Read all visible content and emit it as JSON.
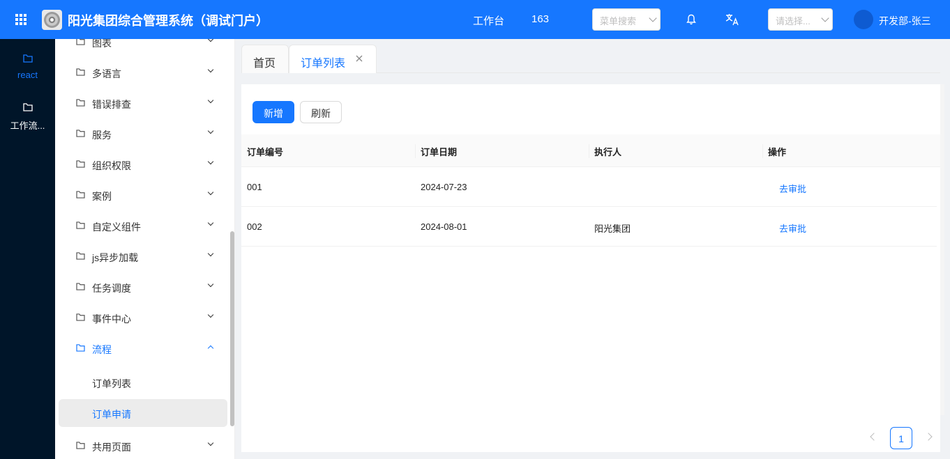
{
  "header": {
    "app_title": "阳光集团综合管理系统（调试门户）",
    "workbench": "工作台",
    "count": "163",
    "menu_search_placeholder": "菜单搜索",
    "org_select_placeholder": "请选择...",
    "user": "开发部-张三"
  },
  "rail": {
    "items": [
      {
        "label": "react",
        "active": true
      },
      {
        "label": "工作流..."
      }
    ]
  },
  "sidebar": {
    "menus": [
      {
        "label": "图表"
      },
      {
        "label": "多语言"
      },
      {
        "label": "错误排查"
      },
      {
        "label": "服务"
      },
      {
        "label": "组织权限"
      },
      {
        "label": "案例"
      },
      {
        "label": "自定义组件"
      },
      {
        "label": "js异步加载"
      },
      {
        "label": "任务调度"
      },
      {
        "label": "事件中心"
      },
      {
        "label": "流程",
        "open": true
      },
      {
        "label": "共用页面"
      }
    ],
    "sub_items": [
      {
        "label": "订单列表"
      },
      {
        "label": "订单申请",
        "selected": true
      }
    ]
  },
  "tabs": [
    {
      "label": "首页"
    },
    {
      "label": "订单列表",
      "active": true
    }
  ],
  "toolbar": {
    "add_label": "新增",
    "refresh_label": "刷新"
  },
  "table": {
    "columns": [
      "订单编号",
      "订单日期",
      "执行人",
      "操作"
    ],
    "rows": [
      {
        "id": "001",
        "date": "2024-07-23",
        "executor": "",
        "action": "去审批"
      },
      {
        "id": "002",
        "date": "2024-08-01",
        "executor": "阳光集团",
        "action": "去审批"
      }
    ]
  },
  "pagination": {
    "current": "1"
  },
  "colors": {
    "primary": "#1677ff",
    "rail_bg": "#001529",
    "selected_bg": "#ececec"
  }
}
